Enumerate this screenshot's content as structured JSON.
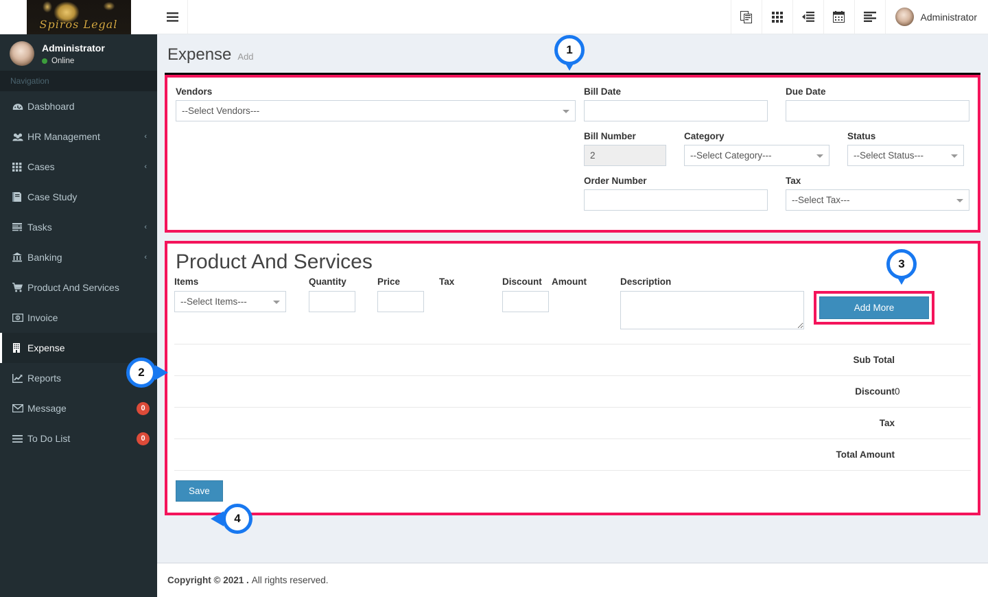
{
  "brand": {
    "logo_text": "Spiros Legal"
  },
  "sidebar": {
    "user_name": "Administrator",
    "user_status": "Online",
    "nav_header": "Navigation",
    "items": [
      {
        "label": "Dasbhoard",
        "icon": "dashboard-icon",
        "caret": "",
        "badge": "",
        "active": false
      },
      {
        "label": "HR Management",
        "icon": "users-icon",
        "caret": "‹",
        "badge": "",
        "active": false
      },
      {
        "label": "Cases",
        "icon": "grid-icon",
        "caret": "‹",
        "badge": "",
        "active": false
      },
      {
        "label": "Case Study",
        "icon": "book-icon",
        "caret": "",
        "badge": "",
        "active": false
      },
      {
        "label": "Tasks",
        "icon": "tasks-icon",
        "caret": "‹",
        "badge": "",
        "active": false
      },
      {
        "label": "Banking",
        "icon": "bank-icon",
        "caret": "‹",
        "badge": "",
        "active": false
      },
      {
        "label": "Product And Services",
        "icon": "cart-icon",
        "caret": "",
        "badge": "",
        "active": false
      },
      {
        "label": "Invoice",
        "icon": "money-icon",
        "caret": "",
        "badge": "",
        "active": false
      },
      {
        "label": "Expense",
        "icon": "building-icon",
        "caret": "",
        "badge": "",
        "active": true
      },
      {
        "label": "Reports",
        "icon": "chart-line-icon",
        "caret": "",
        "badge": "",
        "active": false
      },
      {
        "label": "Message",
        "icon": "envelope-icon",
        "caret": "",
        "badge": "0",
        "active": false
      },
      {
        "label": "To Do List",
        "icon": "list-icon",
        "caret": "",
        "badge": "0",
        "active": false
      }
    ]
  },
  "topbar": {
    "menu_toggle": "hamburger-icon",
    "icons": [
      "clone-icon",
      "grid-icon",
      "indent-icon",
      "calendar-icon",
      "align-left-icon"
    ],
    "user_name": "Administrator"
  },
  "page": {
    "title": "Expense",
    "subtitle": "Add"
  },
  "form": {
    "vendors_label": "Vendors",
    "vendors_value": "--Select Vendors---",
    "bill_date_label": "Bill Date",
    "bill_date_value": "",
    "due_date_label": "Due Date",
    "due_date_value": "",
    "bill_number_label": "Bill Number",
    "bill_number_value": "2",
    "category_label": "Category",
    "category_value": "--Select Category---",
    "status_label": "Status",
    "status_value": "--Select Status---",
    "order_number_label": "Order Number",
    "order_number_value": "",
    "tax_label": "Tax",
    "tax_value": "--Select Tax---"
  },
  "products": {
    "title": "Product And Services",
    "columns": [
      "Items",
      "Quantity",
      "Price",
      "Tax",
      "Discount",
      "Amount",
      "Description"
    ],
    "row": {
      "items_value": "--Select Items---",
      "quantity_value": "",
      "price_value": "",
      "tax_value": "",
      "discount_value": "",
      "amount_value": "",
      "description_value": ""
    },
    "add_more_label": "Add More",
    "totals": [
      {
        "label": "Sub Total",
        "value": ""
      },
      {
        "label": "Discount",
        "value": "0"
      },
      {
        "label": "Tax",
        "value": ""
      },
      {
        "label": "Total Amount",
        "value": ""
      }
    ],
    "save_label": "Save"
  },
  "footer": {
    "copyright_bold": "Copyright © 2021 .",
    "copyright_rest": "All rights reserved."
  },
  "callouts": [
    {
      "number": "1"
    },
    {
      "number": "2"
    },
    {
      "number": "3"
    },
    {
      "number": "4"
    }
  ],
  "colors": {
    "highlight": "#f4145b",
    "callout": "#1878f0",
    "primary_button": "#3c8dbc",
    "sidebar": "#222d32",
    "badge": "#dd4b39"
  }
}
